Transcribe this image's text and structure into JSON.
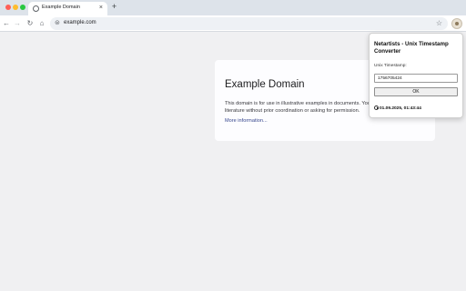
{
  "browser": {
    "tab": {
      "title": "Example Domain",
      "close": "×"
    },
    "new_tab": "+",
    "nav": {
      "back": "←",
      "forward": "→",
      "reload": "↻",
      "home": "⌂"
    },
    "omnibox": {
      "site_icon": "⊜",
      "url": "example.com",
      "bookmark": "☆"
    },
    "extension_icon": "timestamp-extension-icon"
  },
  "page": {
    "heading": "Example Domain",
    "body_line1": "This domain is for use in illustrative examples in documents. You",
    "body_line2": "literature without prior coordination or asking for permission.",
    "link": "More information..."
  },
  "popup": {
    "title": "Netartists - Unix Timestamp Converter",
    "label": "Unix Timestamp:",
    "input_value": "1756705424",
    "ok_label": "OK",
    "result": "01.09.2025, 01:43:44"
  },
  "colors": {
    "page_bg": "#f0f0f2",
    "link": "#38488f",
    "tabstrip": "#dde3ea"
  }
}
